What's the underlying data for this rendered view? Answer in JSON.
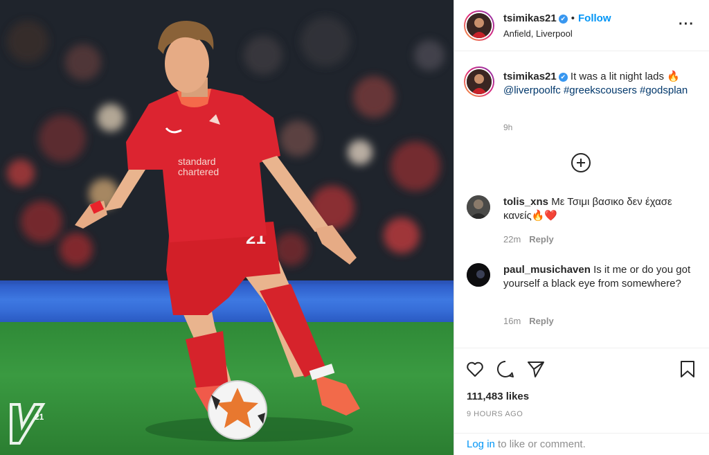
{
  "post_header": {
    "username": "tsimikas21",
    "verified_mark": "✔",
    "separator": "•",
    "follow_label": "Follow",
    "location": "Anfield, Liverpool",
    "more_icon": "···"
  },
  "caption": {
    "username": "tsimikas21",
    "text": "It was a lit night lads 🔥",
    "mention": "@liverpoolfc",
    "hashtag1": "#greekscousers",
    "hashtag2": "#godsplan",
    "time": "9h"
  },
  "comments": [
    {
      "username": "tolis_xns",
      "text": "Με Τσιμι βασικο δεν έχασε κανείς🔥❤️",
      "time": "22m",
      "reply_label": "Reply"
    },
    {
      "username": "paul_musichaven",
      "text": "Is it me or do you got yourself a black eye from somewhere?",
      "time": "16m",
      "reply_label": "Reply"
    }
  ],
  "actions": {
    "likes_text": "111,483 likes",
    "posted_ago": "9 HOURS AGO",
    "login_link": "Log in",
    "login_rest": " to like or comment."
  },
  "icons": [
    "heart-icon",
    "comment-icon",
    "share-icon",
    "bookmark-icon",
    "more-icon",
    "add-comment-icon",
    "verified-icon"
  ],
  "colors": {
    "accent": "#0095f6",
    "hashtag": "#00376b",
    "muted": "#8e8e8e",
    "kit_red": "#d6232b"
  }
}
